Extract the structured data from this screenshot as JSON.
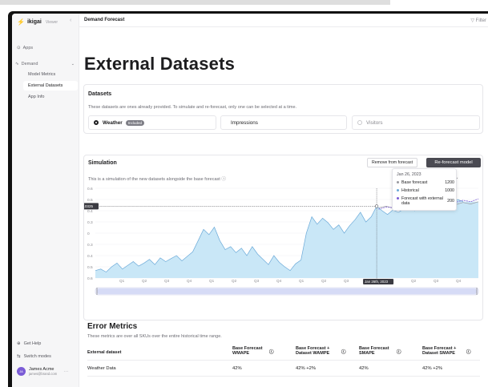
{
  "brand": {
    "name": "ikigai",
    "kind": "Viewer"
  },
  "topbar": {
    "breadcrumb": "Demand Forecast",
    "filter_label": "Filter"
  },
  "sidebar": {
    "apps_label": "Apps",
    "demand_label": "Demand",
    "items": [
      "Model Metrics",
      "External Datasets",
      "App Info"
    ],
    "active_item": "External Datasets",
    "help_label": "Get Help",
    "switch_label": "Switch modes",
    "user": {
      "initials": "JA",
      "name": "James Acme",
      "email": "james@brand.com"
    }
  },
  "page": {
    "title": "External Datasets"
  },
  "datasets": {
    "title": "Datasets",
    "description": "These datasets are ones already provided. To simulate and re-forecast, only one can be selected at a time.",
    "options": [
      {
        "label": "Weather",
        "badge": "Included",
        "selected": true
      },
      {
        "label": "Impressions",
        "selected": false
      },
      {
        "label": "Visitors",
        "selected": false
      }
    ]
  },
  "simulation": {
    "title": "Simulation",
    "remove_button": "Remove from forecast",
    "reforecast_button": "Re-forecast model",
    "description": "This is a simulation of the new datasets alongside the base forecast ⓘ",
    "legend_select": "end ⌄",
    "crosshair_y_label": "0.0325",
    "crosshair_x_label": "Jan 26th, 2023",
    "tooltip": {
      "date": "Jan 26, 2023",
      "rows": [
        {
          "label": "Base forecast",
          "value": "1200",
          "color": "#9a9aa0"
        },
        {
          "label": "Historical",
          "value": "1000",
          "color": "#6aa9d8"
        },
        {
          "label": "Forecast with external data",
          "value": "200",
          "color": "#7b5cd6"
        }
      ]
    }
  },
  "chart_data": {
    "type": "area",
    "y_ticks": [
      "0.6",
      "0.5",
      "0.4",
      "0.3",
      "0",
      "0.3",
      "0.4",
      "0.5",
      "0.6"
    ],
    "x_ticks": [
      "Q1",
      "Q2",
      "Q3",
      "Q4",
      "Q1",
      "Q2",
      "Q3",
      "Q4",
      "Q1",
      "Q2",
      "Q3",
      "Q4",
      "Q1",
      "Q2",
      "Q3",
      "Q4"
    ],
    "historical": [
      -0.5,
      -0.48,
      -0.52,
      -0.45,
      -0.4,
      -0.48,
      -0.43,
      -0.38,
      -0.44,
      -0.4,
      -0.35,
      -0.42,
      -0.33,
      -0.38,
      -0.34,
      -0.3,
      -0.37,
      -0.31,
      -0.25,
      -0.1,
      0.05,
      -0.02,
      0.08,
      -0.1,
      -0.22,
      -0.18,
      -0.26,
      -0.2,
      -0.3,
      -0.18,
      -0.28,
      -0.35,
      -0.42,
      -0.3,
      -0.39,
      -0.45,
      -0.5,
      -0.41,
      -0.36,
      0.0,
      0.22,
      0.12,
      0.2,
      0.14,
      0.05,
      0.11,
      0.0,
      0.1,
      0.18,
      0.28,
      0.15,
      0.22,
      0.36,
      0.3,
      0.25,
      0.31,
      0.28,
      0.32,
      0.38,
      0.3,
      0.36,
      0.4,
      0.34,
      0.39,
      0.43,
      0.38,
      0.41,
      0.45,
      0.42
    ],
    "base_forecast": [
      0.34,
      0.36,
      0.33,
      0.37,
      0.35,
      0.38,
      0.36,
      0.39,
      0.37,
      0.4,
      0.38,
      0.41,
      0.39,
      0.42
    ],
    "forecast_with_external": [
      0.32,
      0.35,
      0.34,
      0.38,
      0.36,
      0.4,
      0.37,
      0.41,
      0.39,
      0.43,
      0.41,
      0.44,
      0.42,
      0.46
    ],
    "crosshair_index": 52
  },
  "errors": {
    "title": "Error Metrics",
    "description": "These metrics are over all SKUs over the entire historical time range.",
    "columns": [
      "External dataset",
      "Base Forecast WMAPE",
      "Base Forecast + Dataset WAMPE",
      "Base Forecast SMAPE",
      "Base Forecast + Dataset SMAPE"
    ],
    "rows": [
      {
        "dataset": "Weather Data",
        "c1": "42%",
        "c2": "42% +2%",
        "c3": "42%",
        "c4": "42% +2%"
      }
    ]
  },
  "colors": {
    "area_fill": "#c9e7f7",
    "area_stroke": "#6aa9d8",
    "accent": "#7b5cd6",
    "button_dark": "#4a4a52"
  }
}
